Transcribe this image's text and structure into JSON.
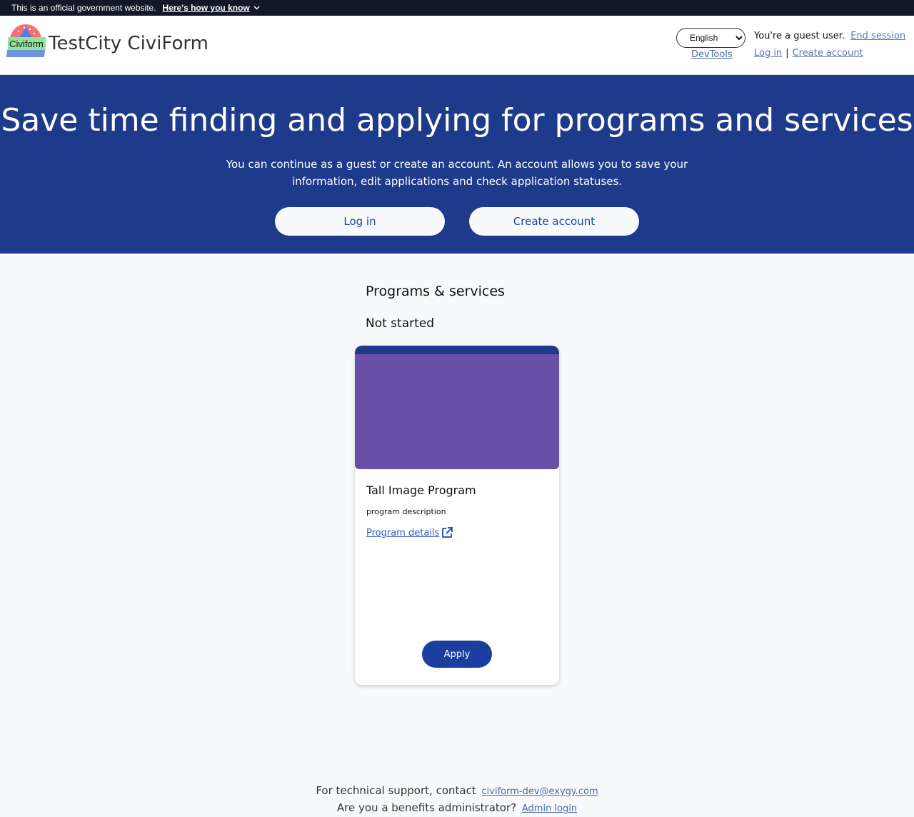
{
  "gov_banner": {
    "text": "This is an official government website.",
    "how_label": "Here's how you know"
  },
  "header": {
    "logo_text": "Civiform",
    "site_title": "TestCity CiviForm",
    "language_selected": "English",
    "devtools_label": "DevTools",
    "guest_text": "You're a guest user.",
    "end_session_label": "End session",
    "login_label": "Log in",
    "separator": "|",
    "create_account_label": "Create account"
  },
  "hero": {
    "title": "Save time finding and applying for programs and services",
    "description": "You can continue as a guest or create an account. An account allows you to save your information, edit applications and check application statuses.",
    "login_button": "Log in",
    "create_account_button": "Create account"
  },
  "main": {
    "section_title": "Programs & services",
    "status_heading": "Not started",
    "programs": [
      {
        "title": "Tall Image Program",
        "description": "program description",
        "details_label": "Program details",
        "apply_label": "Apply"
      }
    ]
  },
  "footer": {
    "support_text": "For technical support, contact",
    "support_email": "civiform-dev@exygy.com",
    "admin_text": "Are you a benefits administrator?",
    "admin_login_label": "Admin login"
  },
  "colors": {
    "banner_bg": "#111827",
    "hero_bg": "#1e3a8a",
    "card_image": "#6a4fa8",
    "apply_button": "#1a3f9e"
  }
}
